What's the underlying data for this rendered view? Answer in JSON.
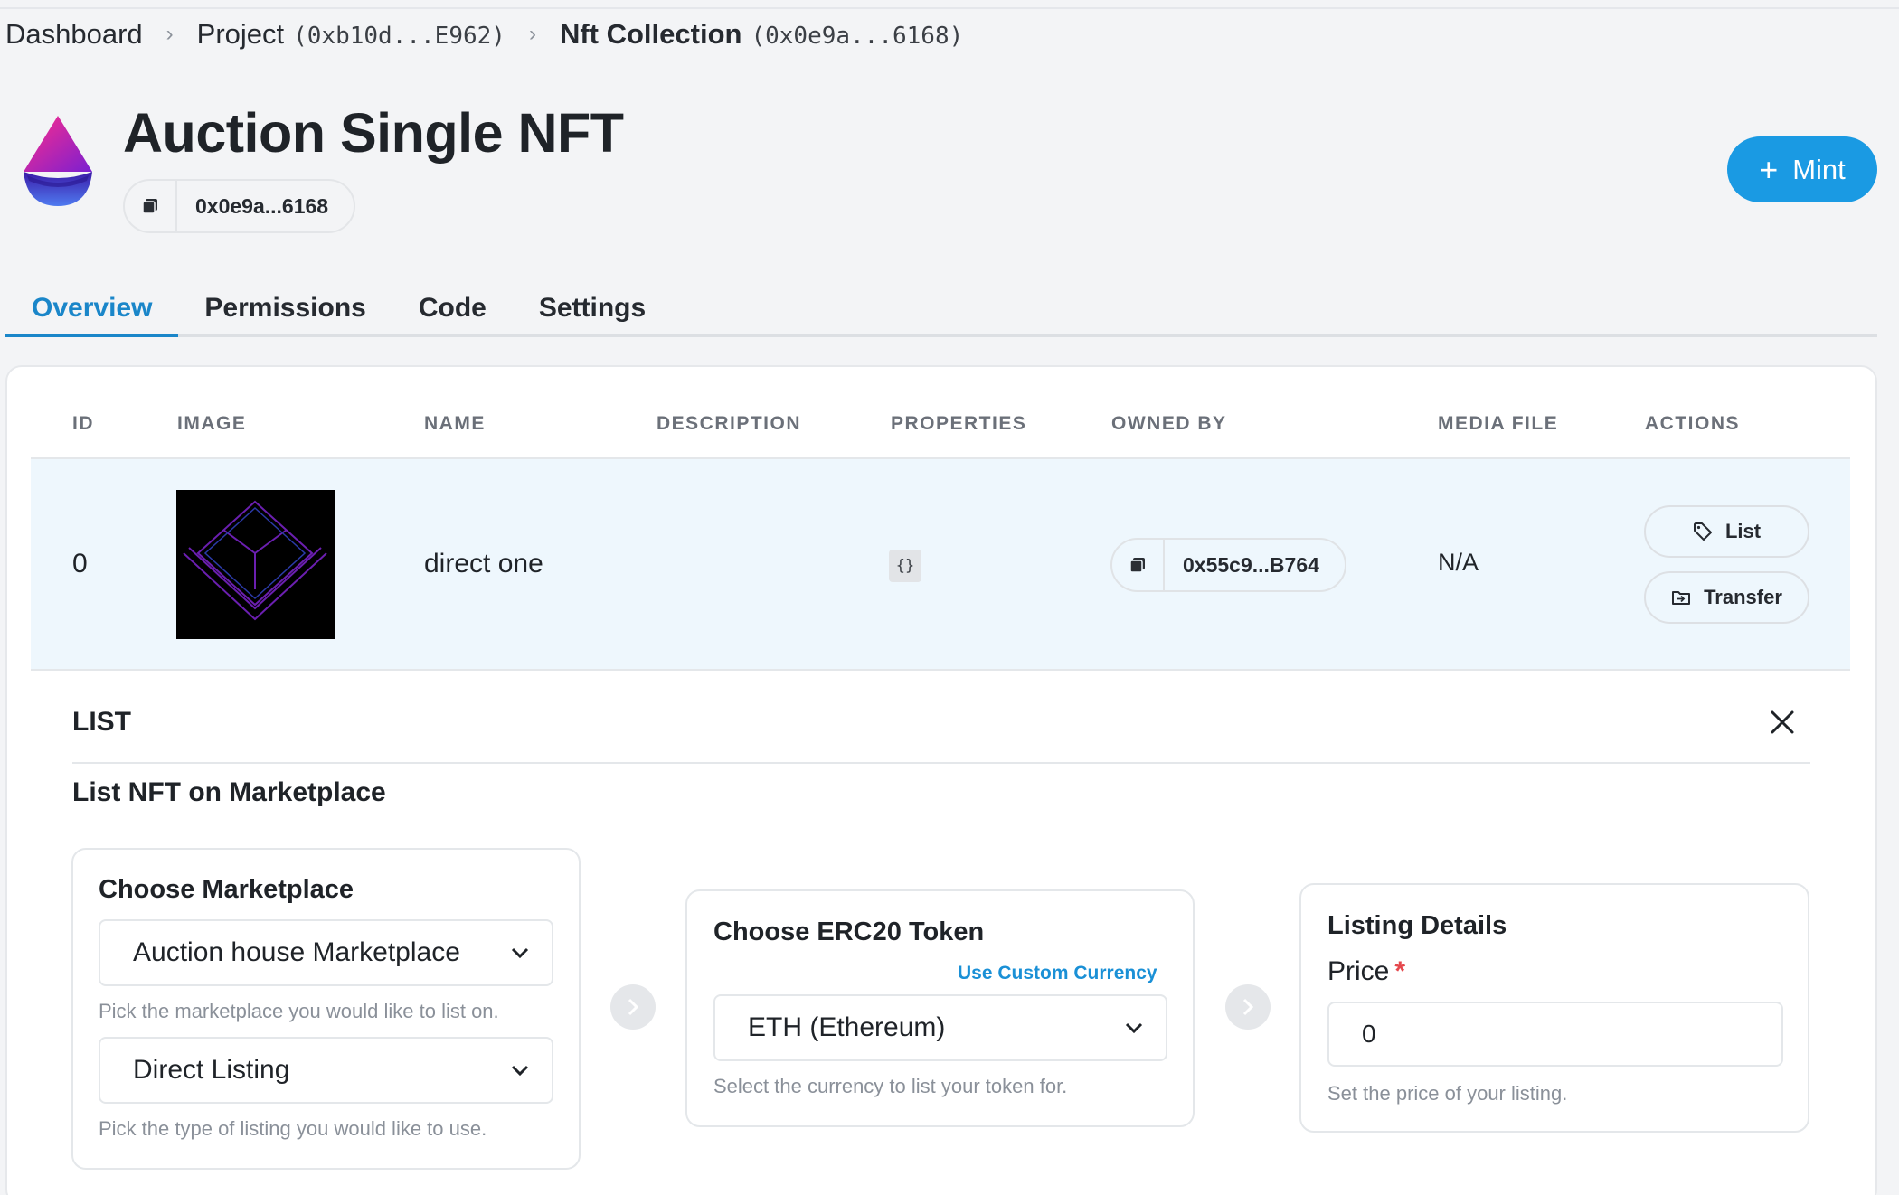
{
  "breadcrumb": {
    "dashboard": "Dashboard",
    "project_label": "Project",
    "project_address": "(0xb10d...E962)",
    "collection_label": "Nft Collection",
    "collection_address": "(0x0e9a...6168)"
  },
  "header": {
    "title": "Auction Single NFT",
    "contract_address": "0x0e9a...6168",
    "mint_label": "Mint"
  },
  "tabs": [
    {
      "label": "Overview",
      "active": true
    },
    {
      "label": "Permissions",
      "active": false
    },
    {
      "label": "Code",
      "active": false
    },
    {
      "label": "Settings",
      "active": false
    }
  ],
  "table": {
    "columns": [
      "ID",
      "IMAGE",
      "NAME",
      "DESCRIPTION",
      "PROPERTIES",
      "OWNED BY",
      "MEDIA FILE",
      "ACTIONS"
    ],
    "rows": [
      {
        "id": "0",
        "name": "direct one",
        "description": "",
        "properties_icon": "{}",
        "owned_by": "0x55c9...B764",
        "media_file": "N/A",
        "actions": {
          "list": "List",
          "transfer": "Transfer"
        }
      }
    ]
  },
  "list_panel": {
    "heading": "LIST",
    "subheading": "List NFT on Marketplace",
    "marketplace": {
      "title": "Choose Marketplace",
      "marketplace_value": "Auction house Marketplace",
      "marketplace_help": "Pick the marketplace you would like to list on.",
      "listing_type_value": "Direct Listing",
      "listing_type_help": "Pick the type of listing you would like to use."
    },
    "token": {
      "title": "Choose ERC20 Token",
      "custom_currency_link": "Use Custom Currency",
      "currency_value": "ETH (Ethereum)",
      "currency_help": "Select the currency to list your token for."
    },
    "details": {
      "title": "Listing Details",
      "price_label": "Price",
      "required_mark": "*",
      "price_value": "0",
      "price_help": "Set the price of your listing."
    }
  },
  "colors": {
    "accent": "#1a9ae3",
    "active_tab": "#1a86c9",
    "row_highlight": "#eef7fd",
    "required": "#e5484d"
  },
  "icons": [
    "chevron-right-icon",
    "copy-icon",
    "plus-icon",
    "tag-icon",
    "transfer-icon",
    "close-icon",
    "chevron-down-icon",
    "arrow-right-icon",
    "braces-icon"
  ]
}
